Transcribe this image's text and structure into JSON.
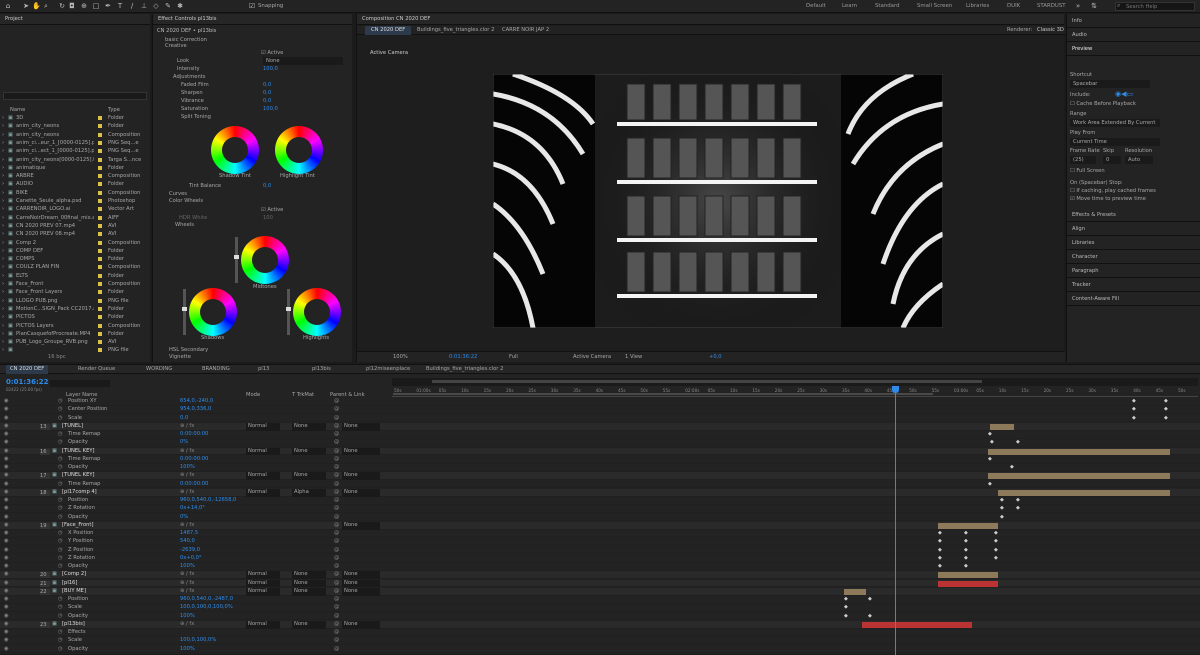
{
  "toolbar": {
    "snapping": "Snapping",
    "workspaces": [
      "Default",
      "Learn",
      "Standard",
      "Small Screen",
      "Libraries",
      "DUIK",
      "STARDUST"
    ],
    "search_placeholder": "Search Help"
  },
  "project": {
    "title": "Project",
    "columns": [
      "Name",
      "Type"
    ],
    "items": [
      {
        "name": "3D",
        "type": "Folder",
        "color": "#d9c24a"
      },
      {
        "name": "anim_city_neons",
        "type": "Folder",
        "color": "#d9c24a"
      },
      {
        "name": "anim_city_neons",
        "type": "Composition",
        "color": "#d9c24a"
      },
      {
        "name": "anim_ci...eur_1_[0000-0125].png",
        "type": "PNG Seq...e",
        "color": "#d9c24a"
      },
      {
        "name": "anim_ci...ect_1_[0000-0125].png",
        "type": "PNG Seq...e",
        "color": "#d9c24a"
      },
      {
        "name": "anim_city_neons[0000-0125].tga",
        "type": "Targa S...nce",
        "color": "#d9c24a"
      },
      {
        "name": "animatique",
        "type": "Folder",
        "color": "#d9c24a"
      },
      {
        "name": "ARBRE",
        "type": "Composition",
        "color": "#d9c24a"
      },
      {
        "name": "AUDIO",
        "type": "Folder",
        "color": "#d9c24a"
      },
      {
        "name": "BIKE",
        "type": "Composition",
        "color": "#d9c24a"
      },
      {
        "name": "Canette_Seule_alpha.psd",
        "type": "Photoshop",
        "color": "#d9c24a"
      },
      {
        "name": "CARRENOIR_LOGO.ai",
        "type": "Vector Art",
        "color": "#d9c24a"
      },
      {
        "name": "CarreNoirDream_00final_mix.aif",
        "type": "AIFF",
        "color": "#d9c24a"
      },
      {
        "name": "CN 2020 PREV 07.mp4",
        "type": "AVI",
        "color": "#d9c24a"
      },
      {
        "name": "CN 2020 PREV 08.mp4",
        "type": "AVI",
        "color": "#d9c24a"
      },
      {
        "name": "Comp 2",
        "type": "Composition",
        "color": "#d9c24a"
      },
      {
        "name": "COMP DEF",
        "type": "Folder",
        "color": "#d9c24a"
      },
      {
        "name": "COMPS",
        "type": "Folder",
        "color": "#d9c24a"
      },
      {
        "name": "COULZ PLAN FIN",
        "type": "Composition",
        "color": "#d9c24a"
      },
      {
        "name": "ELTS",
        "type": "Folder",
        "color": "#d9c24a"
      },
      {
        "name": "Face_Front",
        "type": "Composition",
        "color": "#d9c24a"
      },
      {
        "name": "Face_Front Layers",
        "type": "Folder",
        "color": "#d9c24a"
      },
      {
        "name": "LLOGO PUB.png",
        "type": "PNG file",
        "color": "#d9c24a"
      },
      {
        "name": "MotionC...SIGN_Pack CC2017.aep",
        "type": "Folder",
        "color": "#d9c24a"
      },
      {
        "name": "PICTOS",
        "type": "Folder",
        "color": "#d9c24a"
      },
      {
        "name": "PICTOS Layers",
        "type": "Composition",
        "color": "#d9c24a"
      },
      {
        "name": "PlanCasquefofProcreate.MP4",
        "type": "Folder",
        "color": "#d9c24a"
      },
      {
        "name": "PUB_Logo_Groupe_RVB.png",
        "type": "AVI",
        "color": "#d9c24a"
      },
      {
        "name": "",
        "type": "PNG file",
        "color": "#d9c24a"
      }
    ],
    "footer": "16 bpc"
  },
  "effects": {
    "title": "Effect Controls pl13bis",
    "subtitle": "CN 2020 DEF • pl13bis",
    "props": [
      {
        "label": "basic Correction",
        "value": ""
      },
      {
        "label": "Creative",
        "value": ""
      },
      {
        "label": "",
        "value": "Active"
      },
      {
        "label": "Look",
        "value": "None"
      },
      {
        "label": "Intensity",
        "value": "100,0"
      },
      {
        "label": "Adjustments",
        "value": ""
      },
      {
        "label": "Faded Film",
        "value": "0,0"
      },
      {
        "label": "Sharpen",
        "value": "0,0"
      },
      {
        "label": "Vibrance",
        "value": "0,0"
      },
      {
        "label": "Saturation",
        "value": "100,0"
      },
      {
        "label": "Split Toning",
        "value": ""
      }
    ],
    "wheel_labels": [
      "Shadow Tint",
      "Highlight Tint"
    ],
    "tint_balance": {
      "label": "Tint Balance",
      "value": "0,0"
    },
    "sections": [
      "Curves",
      "Color Wheels"
    ],
    "active2": "Active",
    "hdr": "HDR White",
    "hdr_val": "100",
    "wheels_label": "Wheels",
    "wheel_labels2": [
      "Midtones",
      "Shadows",
      "Highlights"
    ],
    "bottom": [
      "HSL Secondary",
      "Vignette"
    ]
  },
  "comp": {
    "title": "Composition CN 2020 DEF",
    "tabs": [
      "CN 2020 DEF",
      "Buildings_five_triangles.clor 2",
      "CARRE NOIR JAP 2"
    ],
    "renderer": "Renderer:",
    "renderer_val": "Classic 3D",
    "camera_label": "Active Camera",
    "footer": {
      "zoom": "100%",
      "time": "0:01:36:22",
      "quality": "Full",
      "camera": "Active Camera",
      "view": "1 View",
      "plus": "+0,0"
    }
  },
  "right": {
    "items_top": [
      "Info",
      "Audio"
    ],
    "preview": "Preview",
    "shortcut": "Shortcut",
    "shortcut_val": "Spacebar",
    "include": "Include:",
    "cache": "Cache Before Playback",
    "range": "Range",
    "range_val": "Work Area Extended By Current ...",
    "playfrom": "Play From",
    "playfrom_val": "Current Time",
    "fr": "Frame Rate",
    "skip": "Skip",
    "res": "Resolution",
    "fr_val": "(25)",
    "skip_val": "0",
    "res_val": "Auto",
    "fullscreen": "Full Screen",
    "stop": "On (Spacebar) Stop:",
    "opt1": "If caching, play cached frames",
    "opt2": "Move time to preview time",
    "items": [
      "Effects & Presets",
      "Align",
      "Libraries",
      "Character",
      "Paragraph",
      "Tracker",
      "Content-Aware Fill"
    ]
  },
  "timeline": {
    "tabs": [
      "CN 2020 DEF",
      "Render Queue",
      "WORDING",
      "BRANDING",
      "pl13",
      "pl13bis",
      "pl12miseenplace",
      "Buildings_five_triangles.clor 2"
    ],
    "time": "0:01:36:22",
    "time_sub": "02422 (25.00 fps)",
    "headers": [
      "Layer Name",
      "Mode",
      "T TrkMat",
      "Parent & Link"
    ],
    "ruler": [
      "50s",
      "01:00s",
      "05s",
      "10s",
      "15s",
      "20s",
      "25s",
      "30s",
      "35s",
      "40s",
      "45s",
      "50s",
      "55s",
      "02:00s",
      "05s",
      "10s",
      "15s",
      "20s",
      "25s",
      "30s",
      "35s",
      "40s",
      "45s",
      "50s",
      "55s",
      "03:00s",
      "05s",
      "10s",
      "15s",
      "20s",
      "25s",
      "30s",
      "35s",
      "40s",
      "45s",
      "50s"
    ],
    "rows": [
      {
        "num": "",
        "name": "Position XY",
        "val": "654,0,-240,0",
        "kind": "prop"
      },
      {
        "num": "",
        "name": "Center Position",
        "val": "954,0,336,0",
        "kind": "prop"
      },
      {
        "num": "",
        "name": "Scale",
        "val": "0,0",
        "kind": "prop"
      },
      {
        "num": "13",
        "name": "[TUNEL]",
        "kind": "layer",
        "mode": "Normal",
        "trk": "None",
        "parent": "None"
      },
      {
        "num": "",
        "name": "Time Remap",
        "val": "0:00:00:00",
        "kind": "prop"
      },
      {
        "num": "",
        "name": "Opacity",
        "val": "0%",
        "kind": "prop"
      },
      {
        "num": "16",
        "name": "[TUNEL KEY]",
        "kind": "layer",
        "mode": "Normal",
        "trk": "None",
        "parent": "None"
      },
      {
        "num": "",
        "name": "Time Remap",
        "val": "0:00:00:00",
        "kind": "prop"
      },
      {
        "num": "",
        "name": "Opacity",
        "val": "100%",
        "kind": "prop"
      },
      {
        "num": "17",
        "name": "[TUNEL KEY]",
        "kind": "layer",
        "mode": "Normal",
        "trk": "None",
        "parent": "None"
      },
      {
        "num": "",
        "name": "Time Remap",
        "val": "0:00:00:00",
        "kind": "prop"
      },
      {
        "num": "18",
        "name": "[pl17comp 4]",
        "kind": "layer",
        "mode": "Normal",
        "trk": "Alpha",
        "parent": "None"
      },
      {
        "num": "",
        "name": "Position",
        "val": "960,0,540,0,-12658,0",
        "kind": "prop"
      },
      {
        "num": "",
        "name": "Z Rotation",
        "val": "0x+14,0°",
        "kind": "prop"
      },
      {
        "num": "",
        "name": "Opacity",
        "val": "0%",
        "kind": "prop"
      },
      {
        "num": "19",
        "name": "[Face_Front]",
        "kind": "layer",
        "mode": "",
        "trk": "",
        "parent": "None"
      },
      {
        "num": "",
        "name": "X Position",
        "val": "1487,5",
        "kind": "prop"
      },
      {
        "num": "",
        "name": "Y Position",
        "val": "540,0",
        "kind": "prop"
      },
      {
        "num": "",
        "name": "Z Position",
        "val": "-2639,0",
        "kind": "prop"
      },
      {
        "num": "",
        "name": "Z Rotation",
        "val": "0x+0,0°",
        "kind": "prop"
      },
      {
        "num": "",
        "name": "Opacity",
        "val": "100%",
        "kind": "prop"
      },
      {
        "num": "20",
        "name": "[Comp 2]",
        "kind": "layer",
        "mode": "Normal",
        "trk": "None",
        "parent": "None"
      },
      {
        "num": "21",
        "name": "[pl16]",
        "kind": "layer",
        "mode": "Normal",
        "trk": "None",
        "parent": "None"
      },
      {
        "num": "22",
        "name": "[BUY ME]",
        "kind": "layer",
        "mode": "Normal",
        "trk": "None",
        "parent": "None"
      },
      {
        "num": "",
        "name": "Position",
        "val": "960,0,540,0,-2487,0",
        "kind": "prop"
      },
      {
        "num": "",
        "name": "Scale",
        "val": "100,0,100,0,100,0%",
        "kind": "prop"
      },
      {
        "num": "",
        "name": "Opacity",
        "val": "100%",
        "kind": "prop"
      },
      {
        "num": "23",
        "name": "[pl13bis]",
        "kind": "layer",
        "mode": "Normal",
        "trk": "None",
        "parent": "None"
      },
      {
        "num": "",
        "name": "Effects",
        "val": "",
        "kind": "prop"
      },
      {
        "num": "",
        "name": "Scale",
        "val": "100,0,100,0%",
        "kind": "prop"
      },
      {
        "num": "",
        "name": "Opacity",
        "val": "100%",
        "kind": "prop"
      }
    ]
  }
}
